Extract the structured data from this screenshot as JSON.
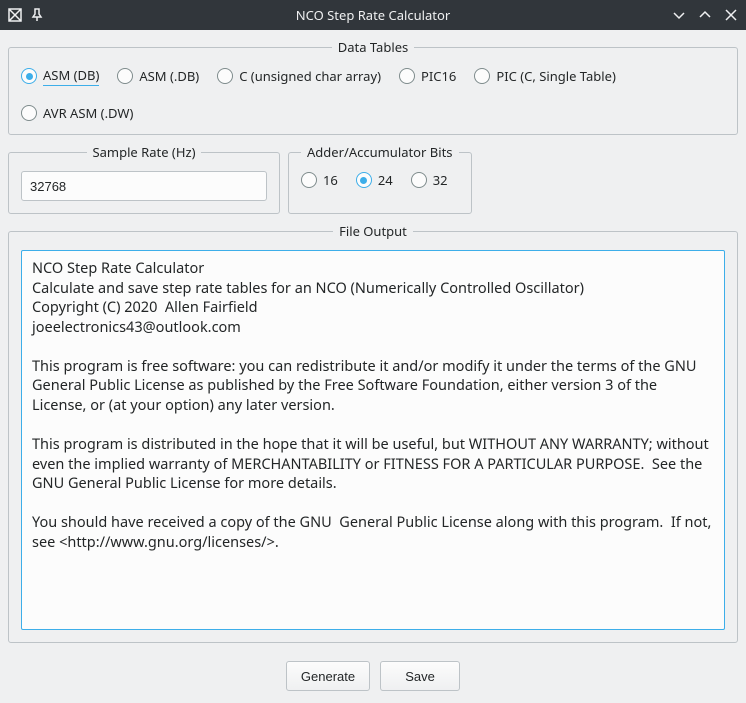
{
  "window": {
    "title": "NCO Step Rate Calculator"
  },
  "dataTables": {
    "legend": "Data Tables",
    "options": [
      {
        "label": "ASM (DB)",
        "selected": true
      },
      {
        "label": "ASM (.DB)",
        "selected": false
      },
      {
        "label": "C (unsigned char array)",
        "selected": false
      },
      {
        "label": "PIC16",
        "selected": false
      },
      {
        "label": "PIC (C, Single Table)",
        "selected": false
      },
      {
        "label": "AVR ASM (.DW)",
        "selected": false
      }
    ]
  },
  "sampleRate": {
    "legend": "Sample Rate (Hz)",
    "value": "32768"
  },
  "bits": {
    "legend": "Adder/Accumulator Bits",
    "options": [
      {
        "label": "16",
        "selected": false
      },
      {
        "label": "24",
        "selected": true
      },
      {
        "label": "32",
        "selected": false
      }
    ]
  },
  "fileOutput": {
    "legend": "File Output",
    "text": "NCO Step Rate Calculator\nCalculate and save step rate tables for an NCO (Numerically Controlled Oscillator)\nCopyright (C) 2020  Allen Fairfield\njoeelectronics43@outlook.com\n\nThis program is free software: you can redistribute it and/or modify it under the terms of the GNU General Public License as published by the Free Software Foundation, either version 3 of the License, or (at your option) any later version.\n\nThis program is distributed in the hope that it will be useful, but WITHOUT ANY WARRANTY; without even the implied warranty of MERCHANTABILITY or FITNESS FOR A PARTICULAR PURPOSE.  See the GNU General Public License for more details.\n\nYou should have received a copy of the GNU  General Public License along with this program.  If not, see <http://www.gnu.org/licenses/>."
  },
  "buttons": {
    "generate": "Generate",
    "save": "Save"
  }
}
